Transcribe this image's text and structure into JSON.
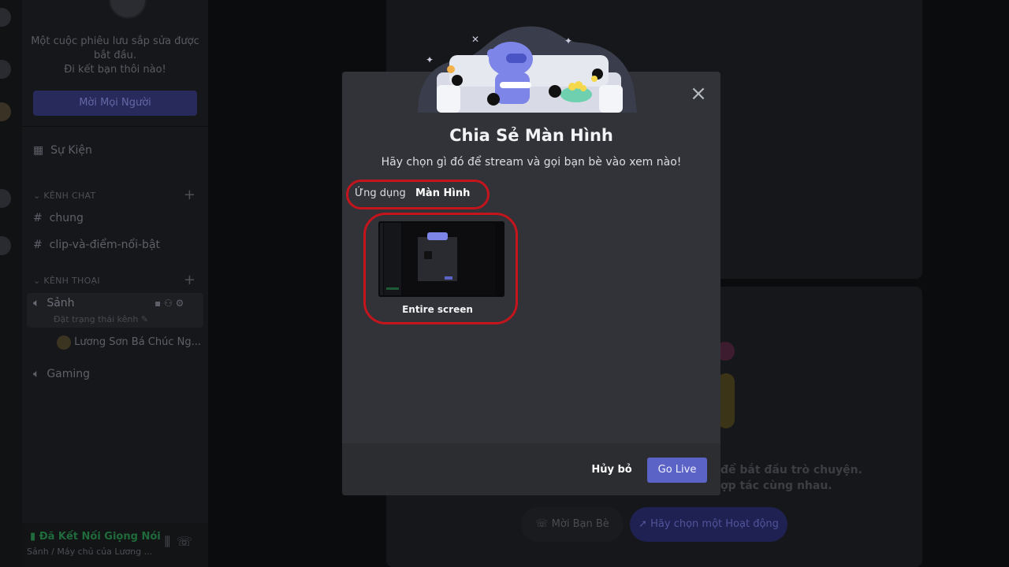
{
  "sidebar": {
    "invite_text_line1": "Một cuộc phiêu lưu sắp sửa được",
    "invite_text_line2": "bắt đầu.",
    "invite_text_line3": "Đi kết bạn thôi nào!",
    "invite_button": "Mời Mọi Người",
    "events_label": "Sự Kiện",
    "text_category": "KÊNH CHAT",
    "text_channels": [
      "chung",
      "clip-và-điểm-nổi-bật"
    ],
    "voice_category": "KÊNH THOẠI",
    "active_voice_channel": "Sảnh",
    "active_voice_status": "Đặt trạng thái kênh",
    "voice_member": "Lương Sơn Bá Chúc Ng...",
    "other_voice_channel": "Gaming",
    "voice_connected_title": "Đã Kết Nối Giọng Nói",
    "voice_connected_sub": "Sảnh / Máy chủ của Lương ..."
  },
  "background": {
    "hint_line1": "để bắt đầu trò chuyện.",
    "hint_line2": "ợp tác cùng nhau.",
    "invite_friends_button": "Mời Bạn Bè",
    "activity_button": "Hãy chọn một Hoạt động"
  },
  "modal": {
    "title": "Chia Sẻ Màn Hình",
    "subtitle": "Hãy chọn gì đó để stream và gọi bạn bè vào xem nào!",
    "tabs": [
      {
        "label": "Ứng dụng",
        "selected": false
      },
      {
        "label": "Màn Hình",
        "selected": true
      }
    ],
    "sources": [
      {
        "label": "Entire screen"
      }
    ],
    "cancel_label": "Hủy bỏ",
    "golive_label": "Go Live"
  },
  "colors": {
    "modal_bg": "#313338",
    "footer_bg": "#2b2d31",
    "accent": "#5865f2",
    "annotation": "#c4141c"
  }
}
